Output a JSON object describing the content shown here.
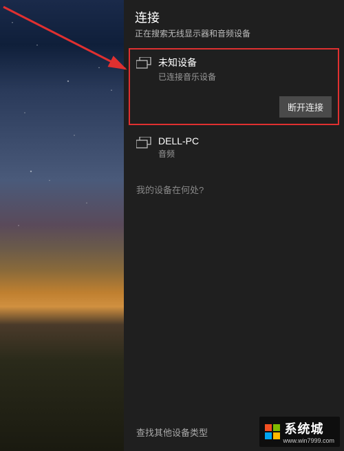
{
  "panel": {
    "title": "连接",
    "subtitle": "正在搜索无线显示器和音频设备"
  },
  "devices": [
    {
      "name": "未知设备",
      "status": "已连接音乐设备",
      "disconnect_label": "断开连接"
    },
    {
      "name": "DELL-PC",
      "status": "音频"
    }
  ],
  "help_link": "我的设备在何处?",
  "bottom_link": "查找其他设备类型",
  "watermark": {
    "brand": "系统城",
    "url": "www.win7999.com"
  }
}
